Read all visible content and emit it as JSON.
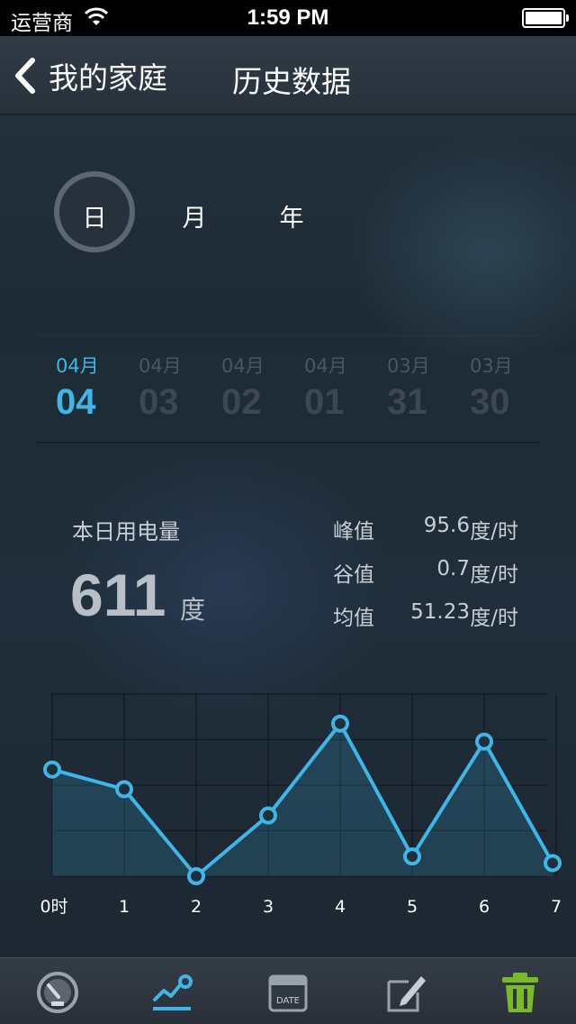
{
  "status_bar": {
    "carrier": "运营商",
    "time": "1:59 PM"
  },
  "nav": {
    "back_label": "我的家庭",
    "title": "历史数据"
  },
  "period": {
    "items": [
      "日",
      "月",
      "年"
    ],
    "selected": "日"
  },
  "dates": [
    {
      "month": "04月",
      "day": "04",
      "active": true
    },
    {
      "month": "04月",
      "day": "03",
      "active": false
    },
    {
      "month": "04月",
      "day": "02",
      "active": false
    },
    {
      "month": "04月",
      "day": "01",
      "active": false
    },
    {
      "month": "03月",
      "day": "31",
      "active": false
    },
    {
      "month": "03月",
      "day": "30",
      "active": false
    }
  ],
  "stats": {
    "label": "本日用电量",
    "value": "611",
    "unit": "度",
    "rows": [
      {
        "key": "峰值",
        "value": "95.6",
        "unit": "度/时"
      },
      {
        "key": "谷值",
        "value": "0.7",
        "unit": "度/时"
      },
      {
        "key": "均值",
        "value": "51.23",
        "unit": "度/时"
      }
    ]
  },
  "colors": {
    "accent": "#3fb6e8",
    "trash": "#7ab929"
  },
  "chart_data": {
    "type": "area",
    "x": [
      "0时",
      "1",
      "2",
      "3",
      "4",
      "5",
      "6",
      "7"
    ],
    "values": [
      65,
      53,
      0,
      37,
      93,
      12,
      82,
      8
    ],
    "ylim": [
      0,
      100
    ],
    "grid": true
  },
  "tabs": [
    {
      "icon": "speedometer-icon",
      "active": false
    },
    {
      "icon": "chart-trend-icon",
      "active": true
    },
    {
      "icon": "calendar-date-icon",
      "active": false,
      "label": "DATE"
    },
    {
      "icon": "edit-note-icon",
      "active": false
    },
    {
      "icon": "trash-icon",
      "active": false
    }
  ]
}
